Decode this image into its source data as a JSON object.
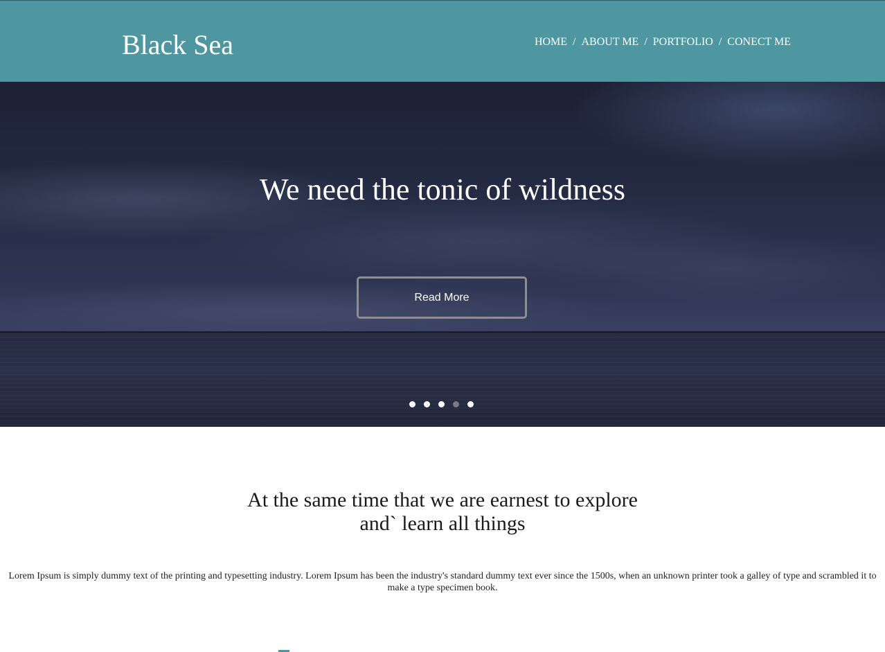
{
  "header": {
    "logo": "Black Sea",
    "nav": [
      {
        "label": "HOME"
      },
      {
        "label": "ABOUT ME"
      },
      {
        "label": "PORTFOLIO"
      },
      {
        "label": "CONECT ME"
      }
    ],
    "separator": "/",
    "background_color": "#4e97a1"
  },
  "hero": {
    "title": "We need the tonic of wildness",
    "button_label": "Read More",
    "slides_count": 5,
    "active_slide": 4
  },
  "intro": {
    "title_line1": "At the same time that we are earnest to explore",
    "title_line2": "and` learn all things",
    "body": "Lorem Ipsum is simply dummy text of the printing and typesetting industry. Lorem Ipsum has been the industry's standard dummy text ever since the 1500s, when an unknown printer took a galley of type and scrambled it to make a type specimen book."
  }
}
